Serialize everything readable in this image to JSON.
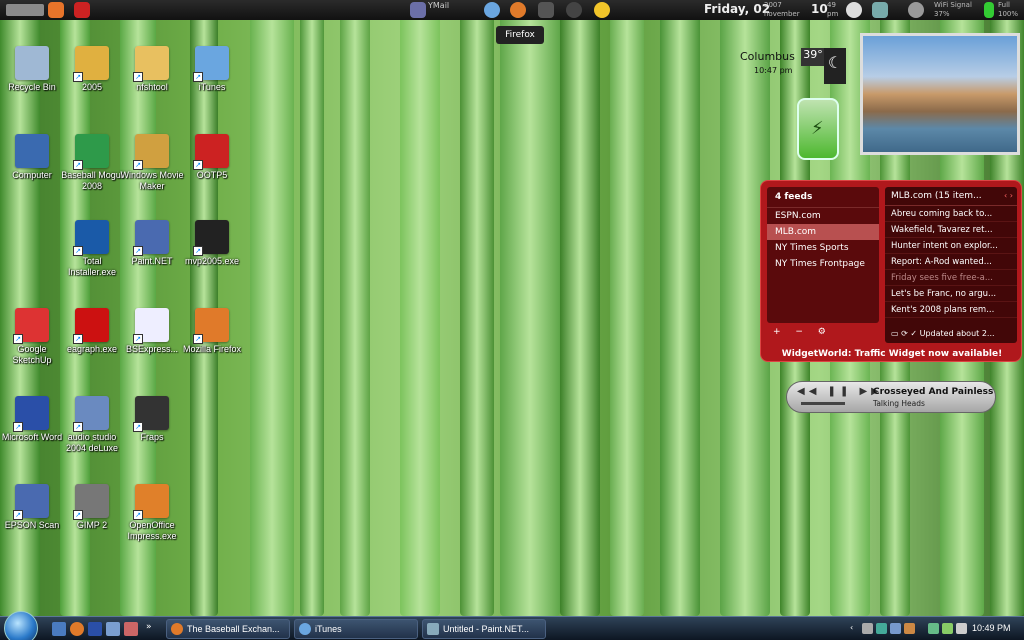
{
  "topbar": {
    "mail_label": "YMail",
    "date_text": "Friday, 02",
    "year": "2007",
    "month": "november",
    "hour": "10",
    "minutes": "49",
    "ampm": "pm",
    "wifi_label": "WiFi Signal",
    "wifi_value": "37%",
    "battery_label": "Full",
    "battery_value": "100%"
  },
  "tooltip": "Firefox",
  "desktop_icons": [
    {
      "label": "Recycle Bin"
    },
    {
      "label": "2005"
    },
    {
      "label": "nfshtool"
    },
    {
      "label": "iTunes"
    },
    {
      "label": "Computer"
    },
    {
      "label": "Baseball Mogul 2008"
    },
    {
      "label": "Windows Movie Maker"
    },
    {
      "label": "OOTP5"
    },
    {
      "label": "Total Installer.exe"
    },
    {
      "label": "Paint.NET"
    },
    {
      "label": "mvp2005.exe"
    },
    {
      "label": "Google SketchUp"
    },
    {
      "label": "eagraph.exe"
    },
    {
      "label": "BSExpress..."
    },
    {
      "label": "Mozilla Firefox"
    },
    {
      "label": "Microsoft Word"
    },
    {
      "label": "audio studio 2004 deLuxe"
    },
    {
      "label": "Fraps"
    },
    {
      "label": "EPSON Scan"
    },
    {
      "label": "GIMP 2"
    },
    {
      "label": "OpenOffice Impress.exe"
    }
  ],
  "weather": {
    "city": "Columbus",
    "temp": "39°",
    "time": "10:47 pm"
  },
  "feeds": {
    "header": "4 feeds",
    "items": [
      "ESPN.com",
      "MLB.com",
      "NY Times Sports",
      "NY Times Frontpage"
    ],
    "controls": "+ − ⚙",
    "news_header": "MLB.com (15 item...",
    "news": [
      "Abreu coming back to...",
      "Wakefield, Tavarez ret...",
      "Hunter intent on explor...",
      "Report: A-Rod wanted...",
      "Friday sees five free-a...",
      "Let's be Franc, no argu...",
      "Kent's 2008 plans rem..."
    ],
    "updated": "Updated about 2...",
    "footer": "WidgetWorld: Traffic Widget now available!"
  },
  "player": {
    "song": "Crosseyed And Painless",
    "artist": "Talking Heads"
  },
  "taskbar": {
    "tasks": [
      "The Baseball Exchan...",
      "iTunes",
      "Untitled - Paint.NET..."
    ],
    "clock": "10:49 PM"
  }
}
